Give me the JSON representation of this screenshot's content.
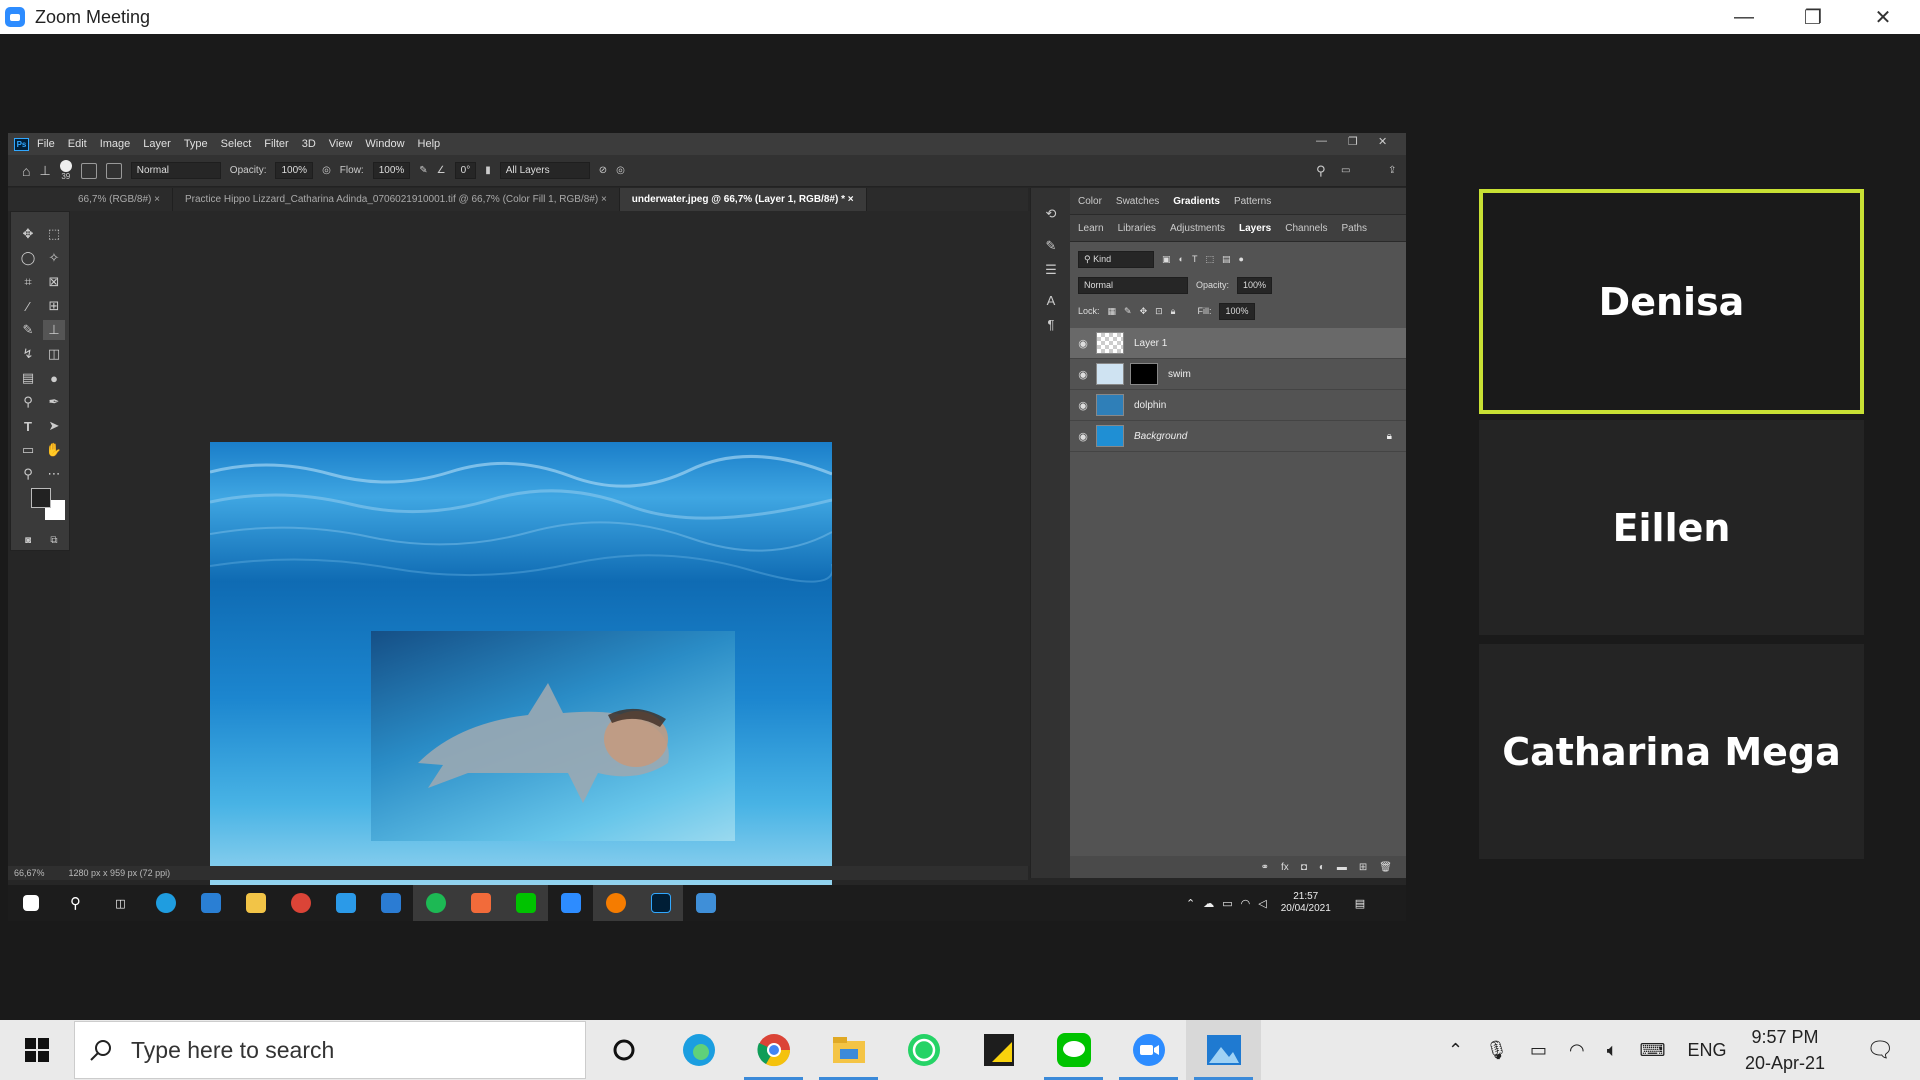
{
  "zoom": {
    "title": "Zoom Meeting",
    "participants": [
      "Denisa",
      "Eillen",
      "Catharina Mega"
    ]
  },
  "photoshop": {
    "menu": [
      "File",
      "Edit",
      "Image",
      "Layer",
      "Type",
      "Select",
      "Filter",
      "3D",
      "View",
      "Window",
      "Help"
    ],
    "options": {
      "brush_size": "39",
      "mode": "Normal",
      "opacity_label": "Opacity:",
      "opacity": "100%",
      "flow_label": "Flow:",
      "flow": "100%",
      "angle": "0°",
      "sample": "All Layers"
    },
    "tabs": [
      "66,7% (RGB/8#)",
      "Practice Hippo Lizzard_Catharina Adinda_0706021910001.tif @ 66,7% (Color Fill 1, RGB/8#)",
      "underwater.jpeg @ 66,7% (Layer 1, RGB/8#) *"
    ],
    "status": {
      "zoom": "66,67%",
      "dimensions": "1280 px x 959 px (72 ppi)"
    },
    "panel_tabs_top": [
      "Color",
      "Swatches",
      "Gradients",
      "Patterns"
    ],
    "panel_tabs_top_active": "Gradients",
    "panel_tabs_mid": [
      "Learn",
      "Libraries",
      "Adjustments",
      "Layers",
      "Channels",
      "Paths"
    ],
    "panel_tabs_mid_active": "Layers",
    "layers_panel": {
      "kind": "Kind",
      "blend": "Normal",
      "opacity_label": "Opacity:",
      "opacity": "100%",
      "lock_label": "Lock:",
      "fill_label": "Fill:",
      "fill": "100%"
    },
    "layers": [
      {
        "name": "Layer 1",
        "selected": true
      },
      {
        "name": "swim",
        "selected": false
      },
      {
        "name": "dolphin",
        "selected": false
      },
      {
        "name": "Background",
        "selected": false
      }
    ],
    "inner_clock": {
      "time": "21:57",
      "date": "20/04/2021"
    }
  },
  "taskbar": {
    "search_placeholder": "Type here to search",
    "lang": "ENG",
    "time": "9:57 PM",
    "date": "20-Apr-21"
  }
}
